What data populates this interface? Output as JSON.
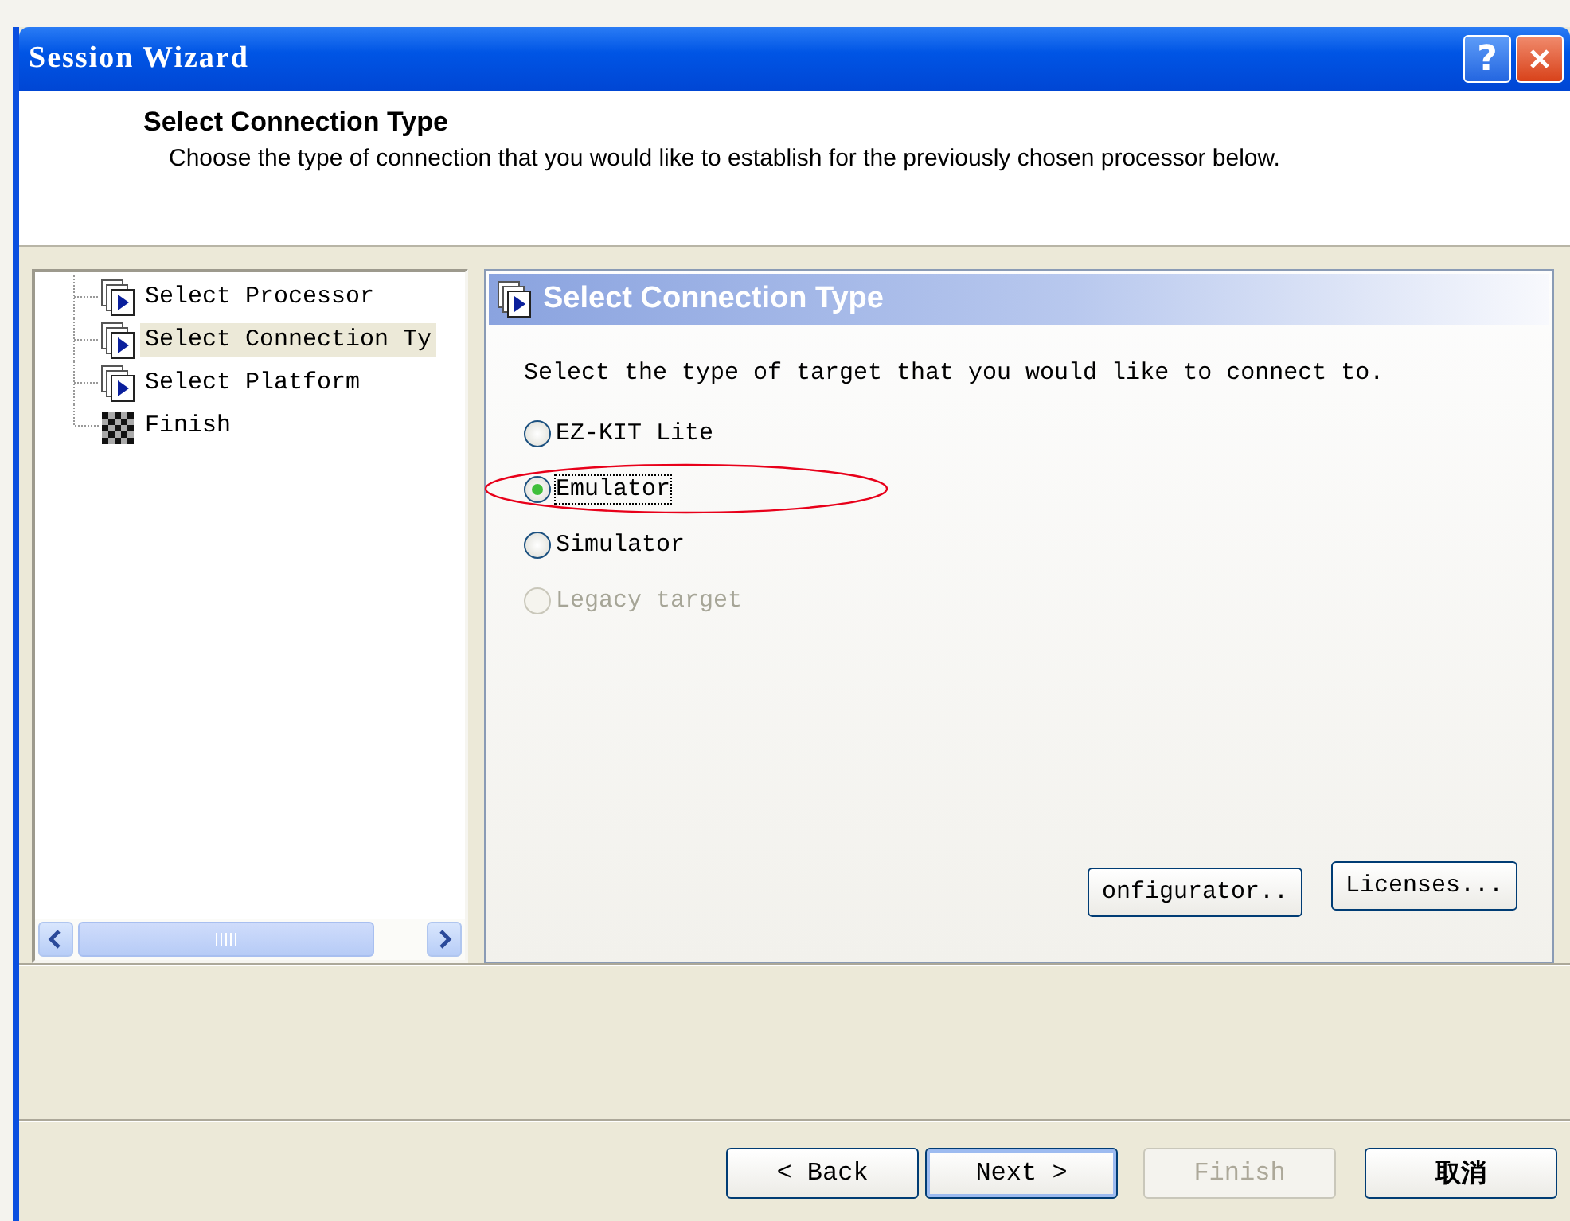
{
  "window": {
    "title": "Session Wizard",
    "help": "?"
  },
  "header": {
    "title": "Select Connection Type",
    "subtitle": "Choose the type of connection that you would like to establish for the previously chosen processor below."
  },
  "tree": {
    "items": [
      {
        "label": "Select Processor",
        "kind": "page",
        "selected": false
      },
      {
        "label": "Select Connection Ty",
        "kind": "page",
        "selected": true
      },
      {
        "label": "Select Platform",
        "kind": "page",
        "selected": false
      },
      {
        "label": "Finish",
        "kind": "finish",
        "selected": false
      }
    ]
  },
  "panel": {
    "title": "Select Connection Type",
    "prompt": "Select the type of target that you would like to connect to.",
    "options": [
      {
        "label": "EZ-KIT Lite",
        "selected": false,
        "disabled": false,
        "highlighted": false
      },
      {
        "label": "Emulator",
        "selected": true,
        "disabled": false,
        "highlighted": true
      },
      {
        "label": "Simulator",
        "selected": false,
        "disabled": false,
        "highlighted": false
      },
      {
        "label": "Legacy target",
        "selected": false,
        "disabled": true,
        "highlighted": false
      }
    ],
    "buttons": [
      "onfigurator..",
      "Licenses..."
    ]
  },
  "footer_buttons": [
    {
      "label": "< Back",
      "disabled": false,
      "default": false
    },
    {
      "label": "Next >",
      "disabled": false,
      "default": true
    },
    {
      "label": "Finish",
      "disabled": true,
      "default": false
    },
    {
      "label": "取消",
      "disabled": false,
      "default": false
    }
  ]
}
